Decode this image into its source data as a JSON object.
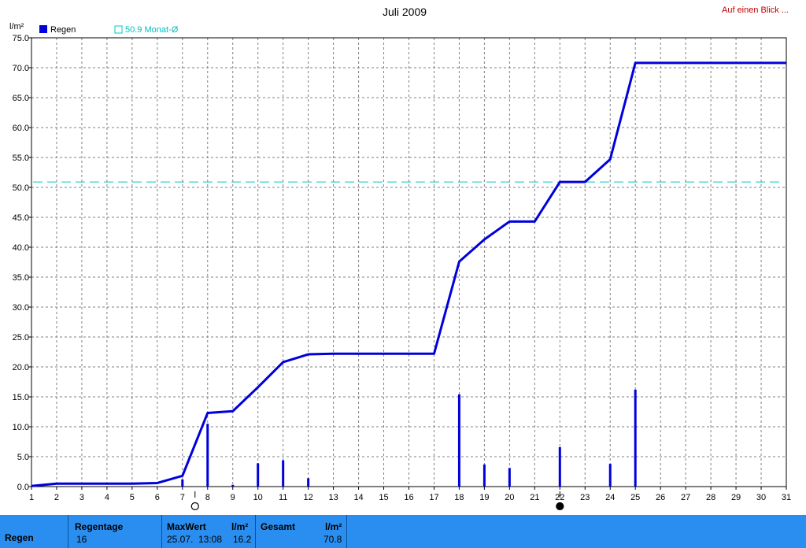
{
  "header": {
    "title": "Juli 2009",
    "link": "Auf einen Blick ..."
  },
  "legend": {
    "series_label": "Regen",
    "reference_label": "50.9 Monat-Ø"
  },
  "colors": {
    "series": "#0000dd",
    "reference": "#00c8c8",
    "grid": "#808080",
    "footer_bg": "#2a8ef0",
    "link": "#c00000"
  },
  "chart_data": {
    "type": "bar",
    "title": "Juli 2009",
    "ylabel": "l/m²",
    "xlim": [
      1,
      31
    ],
    "ylim": [
      0,
      75
    ],
    "yticks": [
      "0.0",
      "5.0",
      "10.0",
      "15.0",
      "20.0",
      "25.0",
      "30.0",
      "35.0",
      "40.0",
      "45.0",
      "50.0",
      "55.0",
      "60.0",
      "65.0",
      "70.0",
      "75.0"
    ],
    "xticks": [
      "1",
      "2",
      "3",
      "4",
      "5",
      "6",
      "7",
      "8",
      "9",
      "10",
      "11",
      "12",
      "13",
      "14",
      "15",
      "16",
      "17",
      "18",
      "19",
      "20",
      "21",
      "22",
      "23",
      "24",
      "25",
      "26",
      "27",
      "28",
      "29",
      "30",
      "31"
    ],
    "grid": true,
    "legend": "top-left",
    "series": [
      {
        "name": "Regen",
        "kind": "bar",
        "x": [
          7,
          8,
          9,
          10,
          11,
          12,
          18,
          19,
          20,
          22,
          24,
          25
        ],
        "values": [
          1.2,
          10.5,
          0.3,
          3.9,
          4.4,
          1.4,
          15.4,
          3.7,
          3.1,
          6.6,
          3.8,
          16.2
        ]
      },
      {
        "name": "",
        "kind": "line",
        "x": [
          1,
          2,
          3,
          4,
          5,
          6,
          7,
          8,
          9,
          10,
          11,
          12,
          13,
          14,
          15,
          16,
          17,
          18,
          19,
          20,
          21,
          22,
          23,
          24,
          25,
          26,
          27,
          28,
          29,
          30,
          31
        ],
        "values": [
          0.1,
          0.5,
          0.5,
          0.5,
          0.5,
          0.6,
          1.8,
          12.3,
          12.6,
          16.6,
          20.8,
          22.1,
          22.2,
          22.2,
          22.2,
          22.2,
          22.2,
          37.6,
          41.3,
          44.3,
          44.3,
          50.9,
          50.9,
          54.7,
          70.8,
          70.8,
          70.8,
          70.8,
          70.8,
          70.8,
          70.8
        ]
      }
    ],
    "reference_line": {
      "label": "50.9 Monat-Ø",
      "value": 50.9,
      "style": "dashed"
    },
    "moon_markers": [
      {
        "x": 7.5,
        "phase": "full"
      },
      {
        "x": 22,
        "phase": "new"
      }
    ]
  },
  "footer": {
    "row_label": "Regen",
    "regentage": {
      "label": "Regentage",
      "value": "16"
    },
    "maxwert": {
      "label": "MaxWert",
      "unit": "l/m²",
      "date": "25.07.",
      "time": "13:08",
      "value": "16.2"
    },
    "gesamt": {
      "label": "Gesamt",
      "unit": "l/m²",
      "value": "70.8"
    }
  }
}
